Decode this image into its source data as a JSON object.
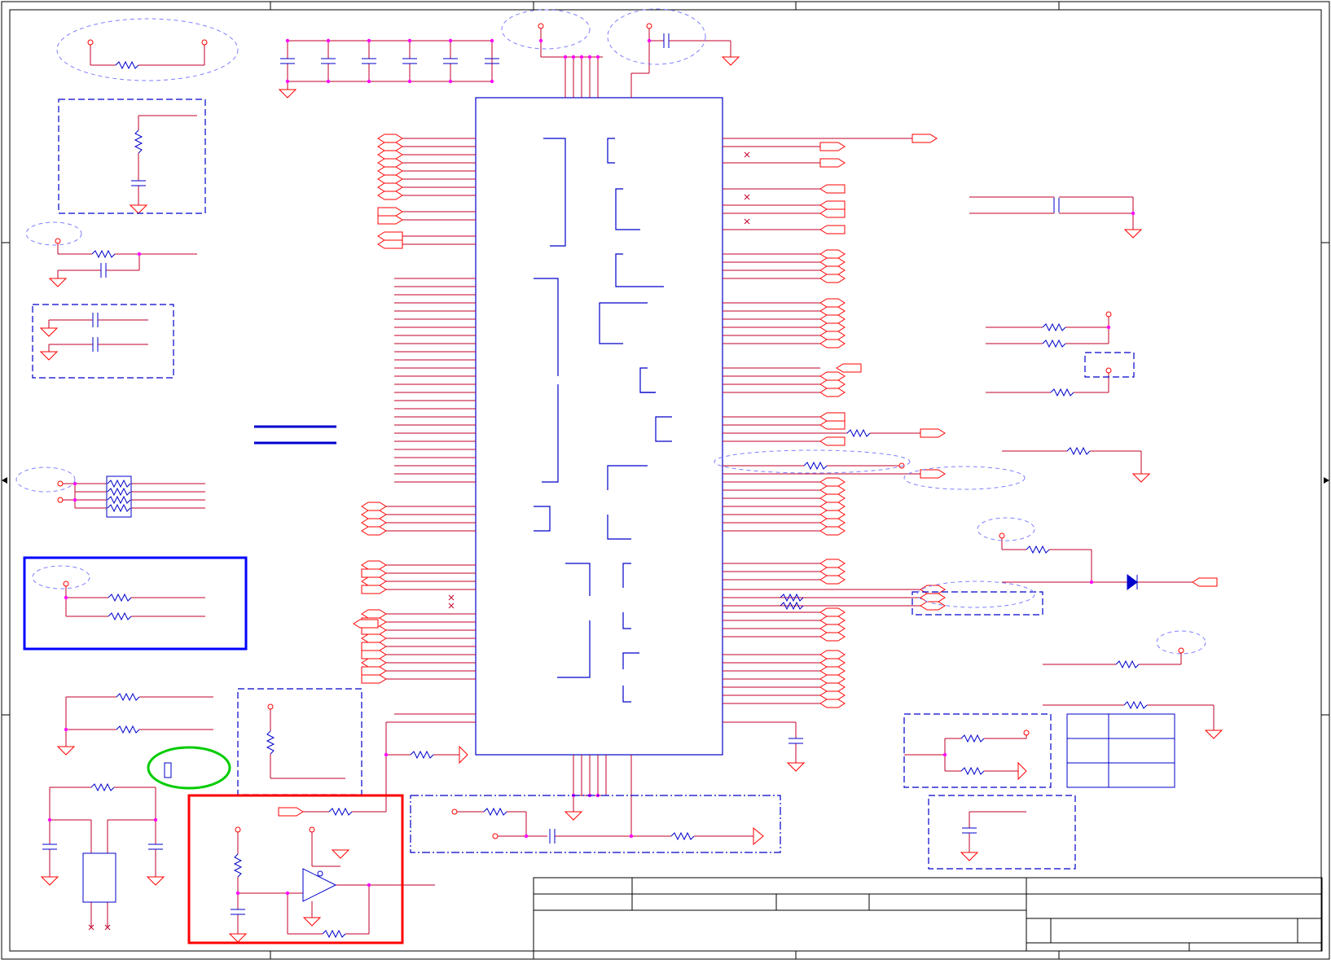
{
  "sheet": {
    "title": "",
    "blocks": {
      "ic_main": "",
      "title_block": ""
    }
  },
  "colors": {
    "wire": "#c0002a",
    "part": "#0000cc",
    "pin": "#ff0000",
    "junction": "#ff00ff",
    "border": "#000000",
    "highlight_red": "#ff0000",
    "highlight_blue": "#0000ff",
    "highlight_green": "#00cc00",
    "dashed_note": "#7f7fff"
  },
  "legend": {
    "items": [
      {
        "name": "resistor-icon"
      },
      {
        "name": "capacitor-icon"
      },
      {
        "name": "ground-icon"
      },
      {
        "name": "port-icon"
      },
      {
        "name": "diode-icon"
      },
      {
        "name": "buffer-icon"
      }
    ]
  }
}
